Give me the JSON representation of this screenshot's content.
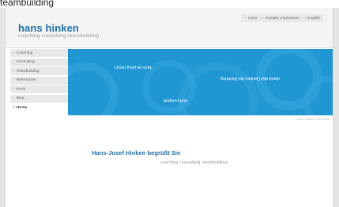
{
  "top_strip": {
    "text": "teambuilding"
  },
  "header": {
    "title": "hans hinken",
    "subtitle": "coaching consulting teambuilding"
  },
  "topnav": {
    "items": [
      {
        "label": "Links"
      },
      {
        "label": "Kontakt, Impressum"
      },
      {
        "label": "English"
      }
    ]
  },
  "sidebar": {
    "items": [
      {
        "label": "Coaching"
      },
      {
        "label": "Consulting"
      },
      {
        "label": "Teambuilding"
      },
      {
        "label": "Referenzen"
      },
      {
        "label": "Profil"
      },
      {
        "label": "Blog"
      },
      {
        "label": "Home",
        "active": true
      }
    ]
  },
  "banner": {
    "line1": "Unser Kopf ist rund,",
    "line2": "damit das Denken die Richtung",
    "line3": "ändern kann."
  },
  "credit": "Francis Picabia, 1879-1953",
  "main": {
    "welcome": "Hans-Josef Hinken begrüßt Sie",
    "tagline": "coaching consulting teambuilding"
  },
  "colors": {
    "brand_blue": "#1f6fa8",
    "banner_blue": "#2097d3",
    "background": "#e4e4e4"
  }
}
